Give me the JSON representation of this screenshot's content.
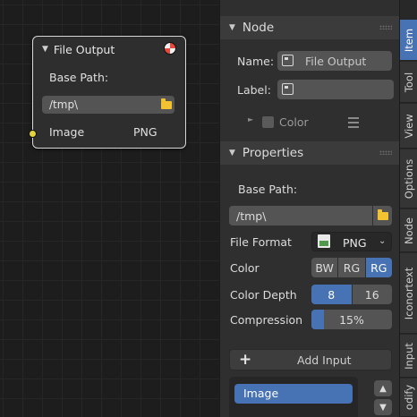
{
  "node_editor": {
    "node": {
      "title": "File Output",
      "base_path_label": "Base Path:",
      "base_path_value": "/tmp\\",
      "input_name": "Image",
      "input_format": "PNG",
      "icons": {
        "collapse": "collapse-triangle-icon",
        "render": "render-result-icon",
        "folder": "folder-icon",
        "socket": "input-socket-icon"
      },
      "colors": {
        "socket": "#e3d33f",
        "border": "#d7d7d7"
      }
    }
  },
  "sidebar": {
    "node_panel": {
      "title": "Node",
      "name_label": "Name:",
      "name_value": "File Output",
      "label_label": "Label:",
      "label_value": "",
      "color_label": "Color"
    },
    "properties_panel": {
      "title": "Properties",
      "base_path_label": "Base Path:",
      "base_path_value": "/tmp\\",
      "file_format_label": "File Format",
      "file_format_value": "PNG",
      "color_label": "Color",
      "color_options": [
        "BW",
        "RG",
        "RG"
      ],
      "color_selected_index": 2,
      "color_depth_label": "Color Depth",
      "color_depth_options": [
        "8",
        "16"
      ],
      "color_depth_selected_index": 0,
      "compression_label": "Compression",
      "compression_value": "15%",
      "compression_fraction": 0.15,
      "add_input_icon": "+",
      "add_input_label": "Add Input",
      "inputs": [
        "Image"
      ],
      "move_up_icon": "▲",
      "move_down_icon": "▼"
    },
    "accent_color": "#4772b3"
  },
  "tabs": [
    "Item",
    "Tool",
    "View",
    "Options",
    "Node",
    "Iconortext",
    "Input",
    "odify"
  ],
  "active_tab": "Item"
}
